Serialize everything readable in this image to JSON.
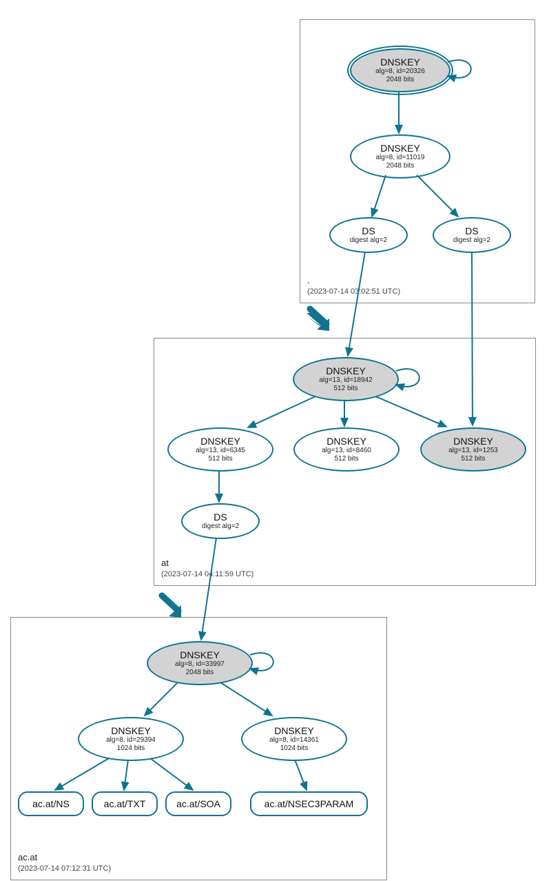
{
  "colors": {
    "stroke": "#0e7490",
    "filled": "#d3d3d3"
  },
  "zones": {
    "root": {
      "label": ".",
      "timestamp": "(2023-07-14 03:02:51 UTC)"
    },
    "at": {
      "label": "at",
      "timestamp": "(2023-07-14 04:11:59 UTC)"
    },
    "acat": {
      "label": "ac.at",
      "timestamp": "(2023-07-14 07:12:31 UTC)"
    }
  },
  "nodes": {
    "root_ksk": {
      "title": "DNSKEY",
      "l1": "alg=8, id=20326",
      "l2": "2048 bits"
    },
    "root_zsk": {
      "title": "DNSKEY",
      "l1": "alg=8, id=11019",
      "l2": "2048 bits"
    },
    "root_ds1": {
      "title": "DS",
      "l1": "digest alg=2"
    },
    "root_ds2": {
      "title": "DS",
      "l1": "digest alg=2"
    },
    "at_ksk": {
      "title": "DNSKEY",
      "l1": "alg=13, id=18942",
      "l2": "512 bits"
    },
    "at_zsk1": {
      "title": "DNSKEY",
      "l1": "alg=13, id=6345",
      "l2": "512 bits"
    },
    "at_zsk2": {
      "title": "DNSKEY",
      "l1": "alg=13, id=8460",
      "l2": "512 bits"
    },
    "at_zsk3": {
      "title": "DNSKEY",
      "l1": "alg=13, id=1253",
      "l2": "512 bits"
    },
    "at_ds": {
      "title": "DS",
      "l1": "digest alg=2"
    },
    "acat_ksk": {
      "title": "DNSKEY",
      "l1": "alg=8, id=33997",
      "l2": "2048 bits"
    },
    "acat_zsk1": {
      "title": "DNSKEY",
      "l1": "alg=8, id=29394",
      "l2": "1024 bits"
    },
    "acat_zsk2": {
      "title": "DNSKEY",
      "l1": "alg=8, id=14361",
      "l2": "1024 bits"
    }
  },
  "rr": {
    "ns": "ac.at/NS",
    "txt": "ac.at/TXT",
    "soa": "ac.at/SOA",
    "n3p": "ac.at/NSEC3PARAM"
  }
}
